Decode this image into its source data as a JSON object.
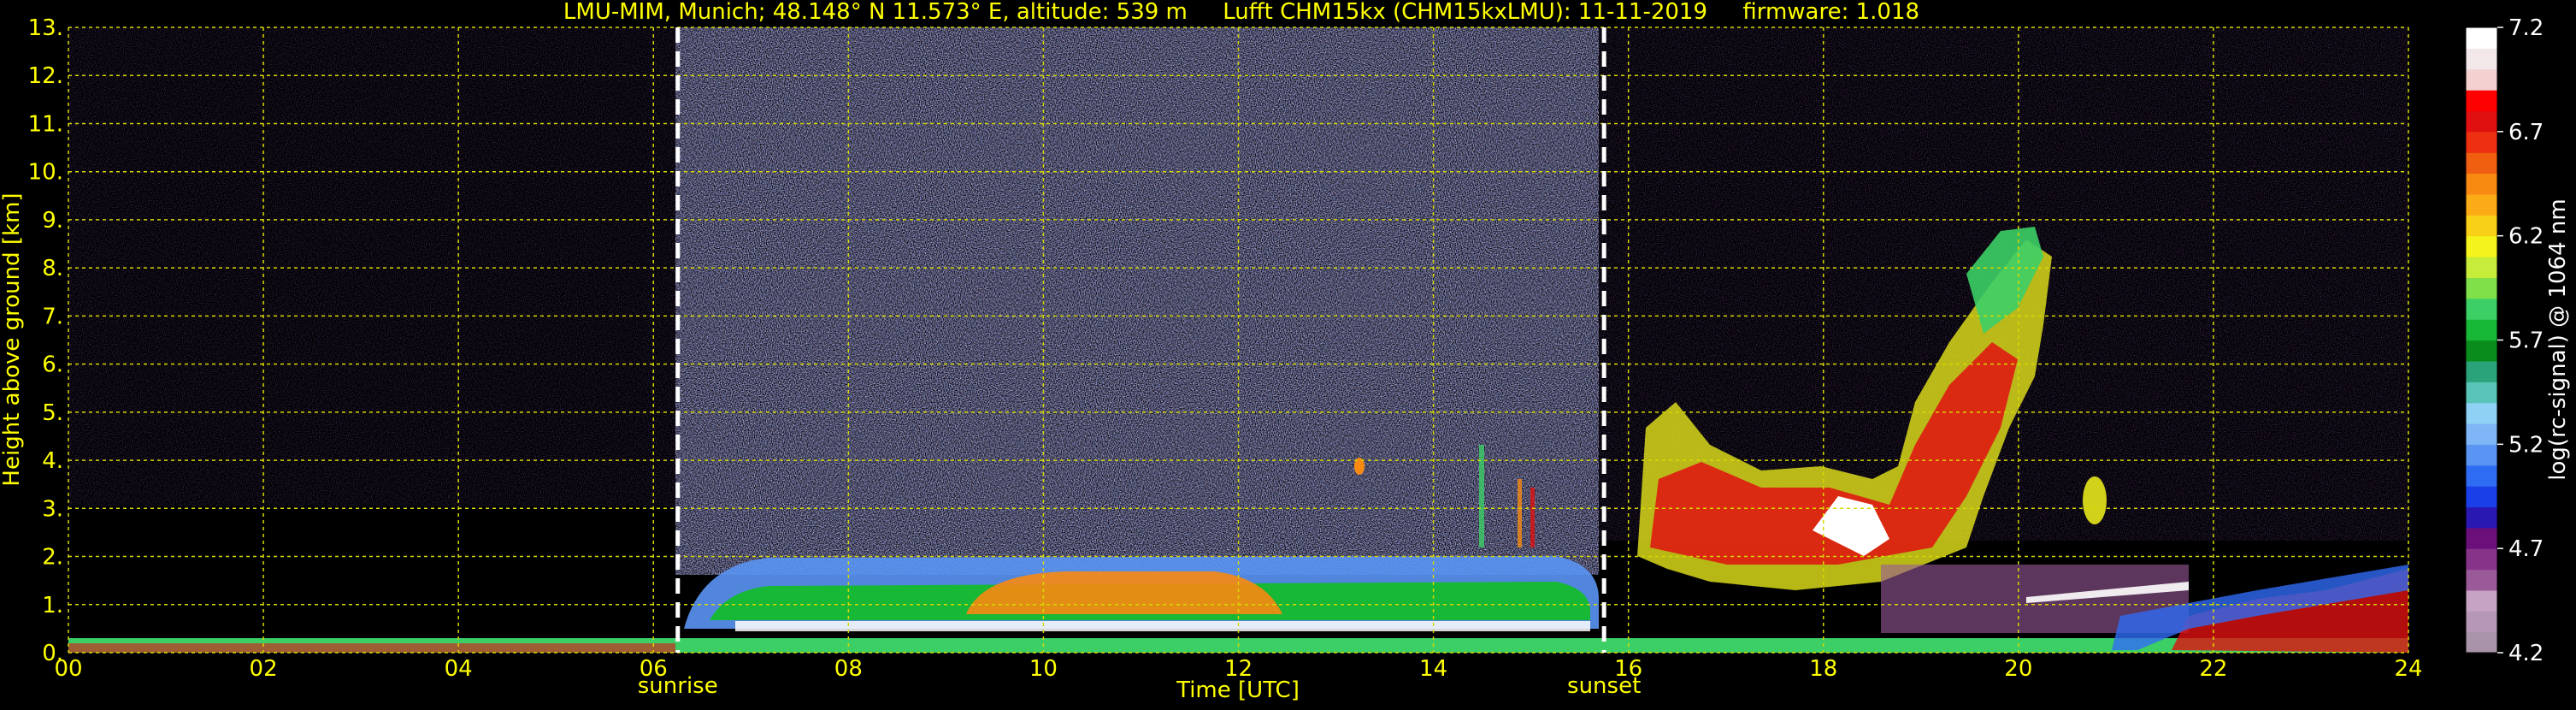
{
  "chart_data": {
    "type": "heatmap",
    "title": "LMU-MIM, Munich; 48.148° N 11.573° E, altitude: 539 m     Lufft CHM15kx (CHM15kxLMU): 11-11-2019     firmware: 1.018",
    "xlabel": "Time [UTC]",
    "ylabel": "Height above ground [km]",
    "colorbar_label": "log(rc-signal) @ 1064 nm",
    "xlim": [
      0,
      24
    ],
    "ylim": [
      0,
      13
    ],
    "x_ticks": [
      "00",
      "02",
      "04",
      "06",
      "08",
      "10",
      "12",
      "14",
      "16",
      "18",
      "20",
      "22",
      "24"
    ],
    "y_ticks": [
      "0.",
      "1.",
      "2.",
      "3.",
      "4.",
      "5.",
      "6.",
      "7.",
      "8.",
      "9.",
      "10.",
      "11.",
      "12.",
      "13."
    ],
    "colorbar_range": [
      4.2,
      7.2
    ],
    "colorbar_ticks": [
      "4.2",
      "4.7",
      "5.2",
      "5.7",
      "6.2",
      "6.7",
      "7.2"
    ],
    "colorbar_colors": [
      "#a893a8",
      "#b697b8",
      "#c6a2c4",
      "#9a5a9a",
      "#88338a",
      "#6b0f7a",
      "#2a18b2",
      "#1a3fe8",
      "#2f6cf4",
      "#5a95f4",
      "#7fb6f8",
      "#8fd1f4",
      "#58c5b8",
      "#2aa37a",
      "#0a8c1c",
      "#16b836",
      "#3ccf66",
      "#80e04a",
      "#c7ec3a",
      "#f4f41c",
      "#f8d018",
      "#fbab16",
      "#f88a12",
      "#f05e10",
      "#ec3010",
      "#e01010",
      "#ff0000",
      "#f4d0d0",
      "#f2e8ea",
      "#ffffff"
    ],
    "grid": true,
    "series": [
      {
        "name": "sunrise",
        "x": 6.25
      },
      {
        "name": "sunset",
        "x": 15.75
      }
    ],
    "colors": {
      "text": "#ffff00",
      "grid": "#d8d800",
      "marker_line": "#ffffff",
      "background": "#000000",
      "axis_label_right": "#ffffff"
    }
  }
}
